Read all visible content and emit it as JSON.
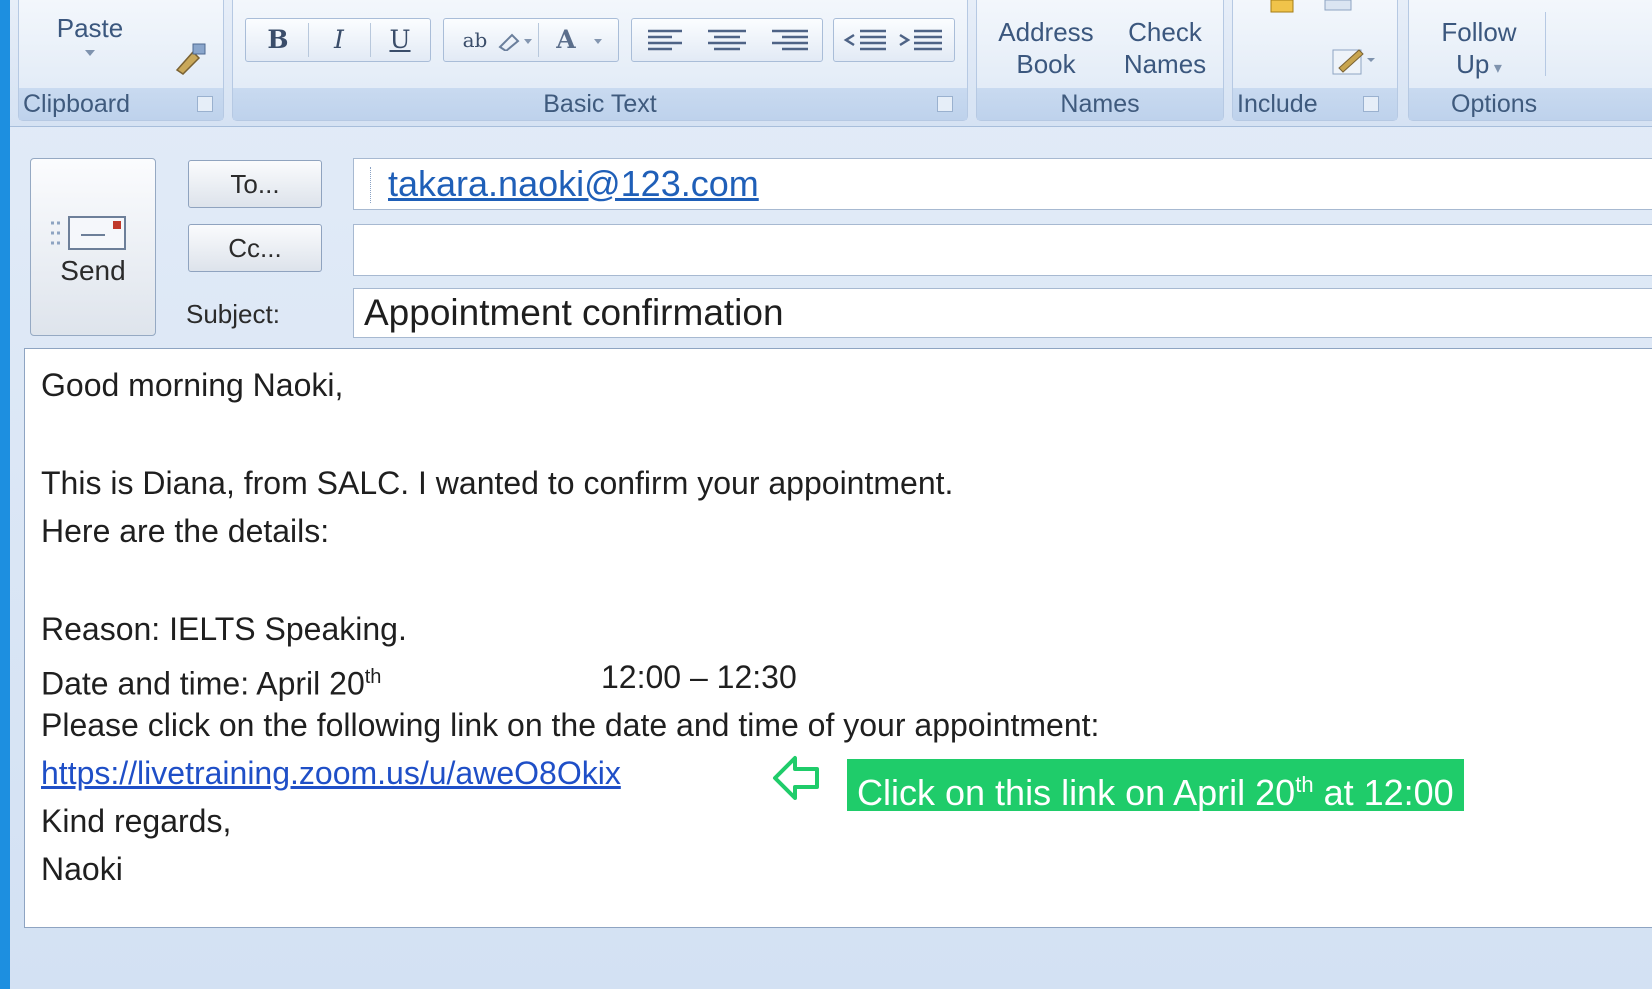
{
  "ribbon": {
    "clipboard": {
      "label": "Clipboard",
      "paste": "Paste"
    },
    "basic_text": {
      "label": "Basic Text",
      "bold": "B",
      "italic": "I",
      "underline": "U",
      "font_color": "A",
      "highlight": "ab"
    },
    "names": {
      "label": "Names",
      "address_book_1": "Address",
      "address_book_2": "Book",
      "check_names_1": "Check",
      "check_names_2": "Names"
    },
    "include": {
      "label": "Include"
    },
    "options": {
      "label": "Options",
      "follow_up_1": "Follow",
      "follow_up_2": "Up"
    }
  },
  "header": {
    "send": "Send",
    "to_button": "To...",
    "cc_button": "Cc...",
    "subject_label": "Subject:",
    "to_value": "takara.naoki@123.com",
    "cc_value": "",
    "subject_value": "Appointment confirmation"
  },
  "body": {
    "greeting": "Good morning Naoki,",
    "intro": "This is Diana, from SALC. I wanted to confirm your appointment.",
    "details_intro": "Here are the details:",
    "reason": "Reason: IELTS Speaking.",
    "date_prefix": "Date and time: April 20",
    "date_suffix": "th",
    "time": "12:00 – 12:30",
    "link_instruction": "Please click on the following link on the date and time of your appointment:",
    "link": "https://livetraining.zoom.us/u/aweO8Okix",
    "closing": "Kind regards,",
    "signature": "Naoki"
  },
  "annotation": {
    "text_prefix": "Click on this link on April 20",
    "text_sup": "th",
    "text_suffix": " at 12:00",
    "color": "#1fcc6a"
  }
}
